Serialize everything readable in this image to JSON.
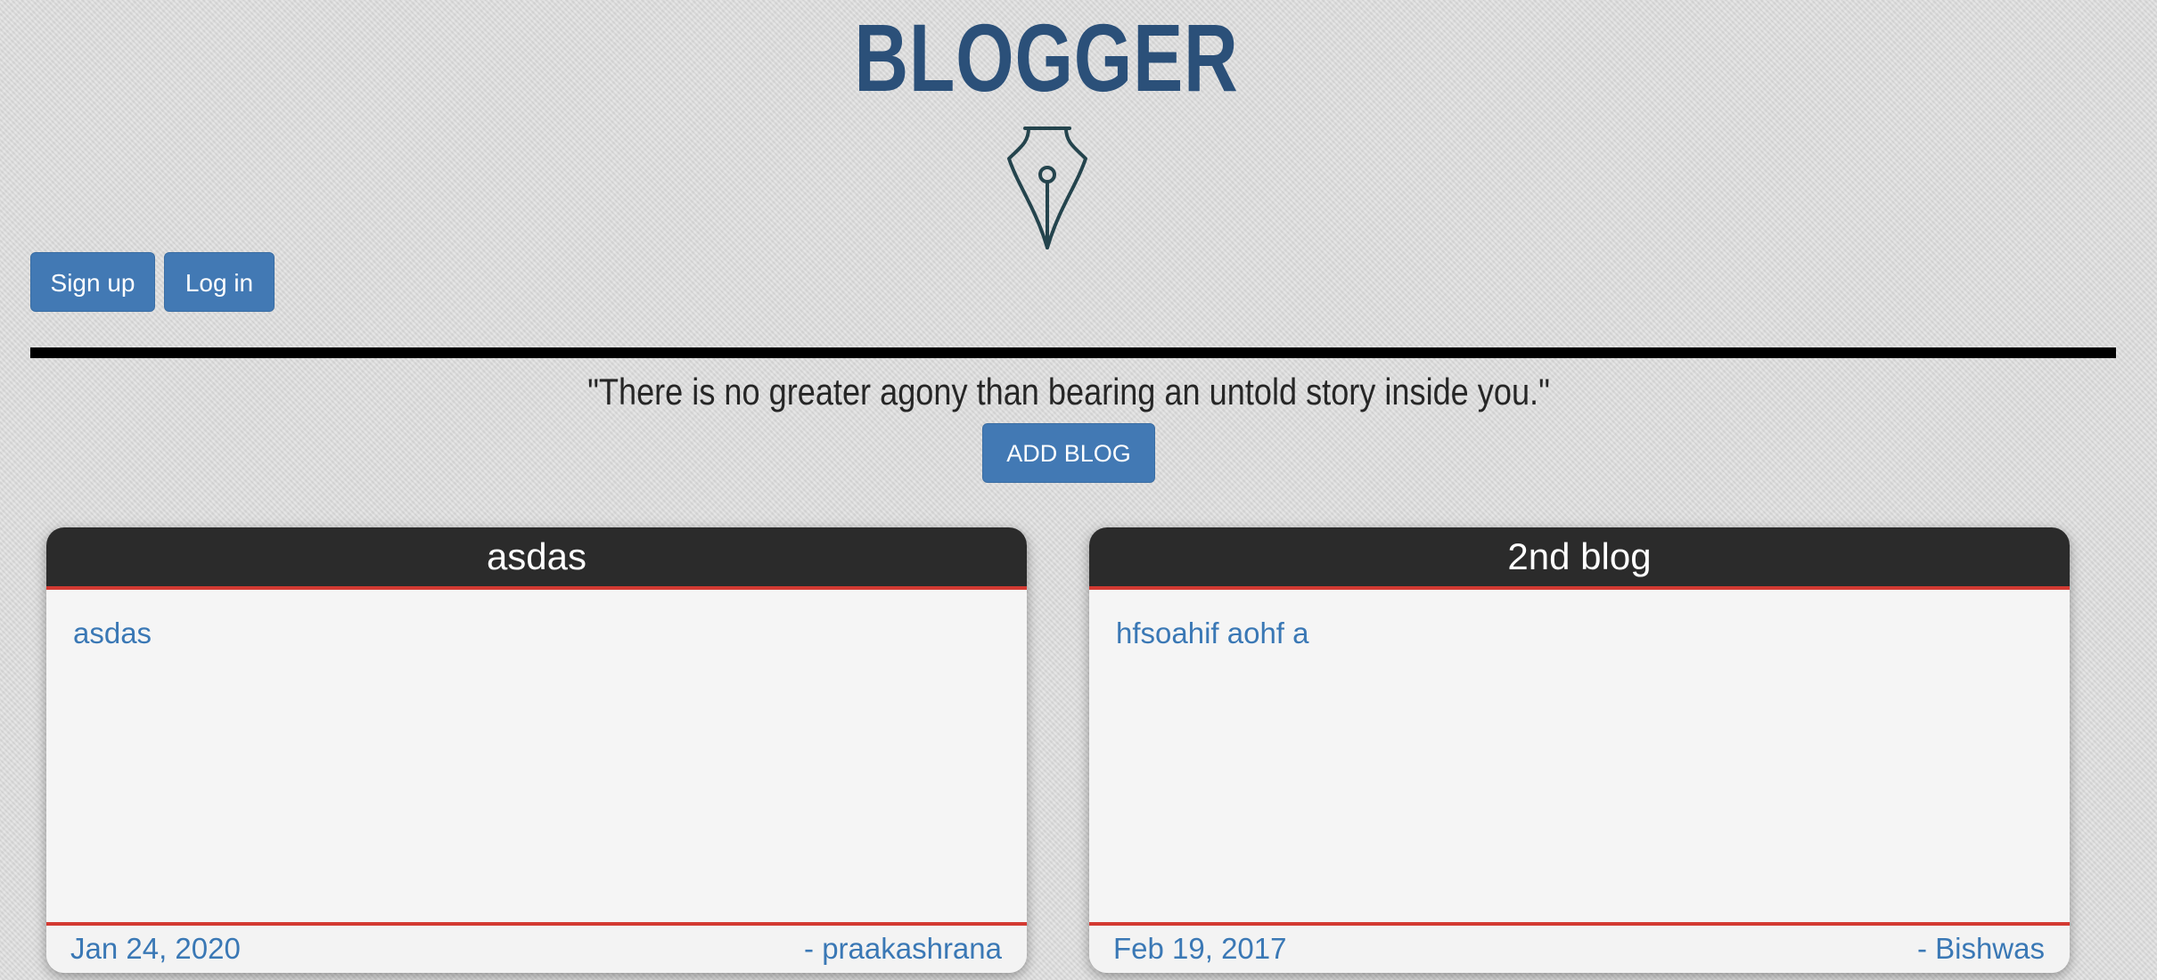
{
  "header": {
    "title": "BLOGGER",
    "logo_icon": "fountain-pen-nib-icon"
  },
  "auth": {
    "signup_label": "Sign up",
    "login_label": "Log in"
  },
  "quote": "\"There is no greater agony than bearing an untold story inside you.\"",
  "add_blog_label": "ADD BLOG",
  "colors": {
    "title": "#2b5079",
    "button": "#4279b4",
    "card_header": "#2b2b2b",
    "accent_red": "#d33a32",
    "link_blue": "#3a78b5"
  },
  "blogs": [
    {
      "title": "asdas",
      "content": "asdas",
      "date": "Jan 24, 2020",
      "author": "- praakashrana"
    },
    {
      "title": "2nd blog",
      "content": "hfsoahif aohf a",
      "date": "Feb 19, 2017",
      "author": "- Bishwas"
    }
  ]
}
